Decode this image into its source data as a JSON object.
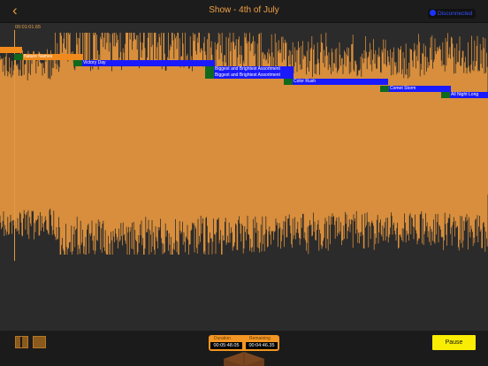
{
  "header": {
    "back_icon": "chevron-left-icon",
    "title": "Show - 4th of July",
    "connect_label": "Disconnected"
  },
  "timeline": {
    "timecode": "00:01:01.65"
  },
  "cues": [
    {
      "label": "",
      "style": "orange"
    },
    {
      "label": "Nature Names",
      "style": "orange"
    },
    {
      "label": "Victory Day",
      "style": "blue"
    },
    {
      "label": "Biggest and Brightest Assortment",
      "style": "blue"
    },
    {
      "label": "Biggest and Brightest Assortment",
      "style": "blue"
    },
    {
      "label": "Color Rush",
      "style": "blue"
    },
    {
      "label": "Comet Storm",
      "style": "blue"
    },
    {
      "label": "All Night Long",
      "style": "blue"
    }
  ],
  "transport": {
    "duration_label": "Duration",
    "remaining_label": "Remaining",
    "duration_value": "00:05:48.05",
    "remaining_value": "00:04:46.35",
    "pause_label": "Pause"
  },
  "colors": {
    "accent": "#f08a1c",
    "waveform": "#d88e3c",
    "cue_blue": "#1a1aff",
    "cue_handle": "#0f6a1e",
    "pause_button": "#f9ee03"
  }
}
